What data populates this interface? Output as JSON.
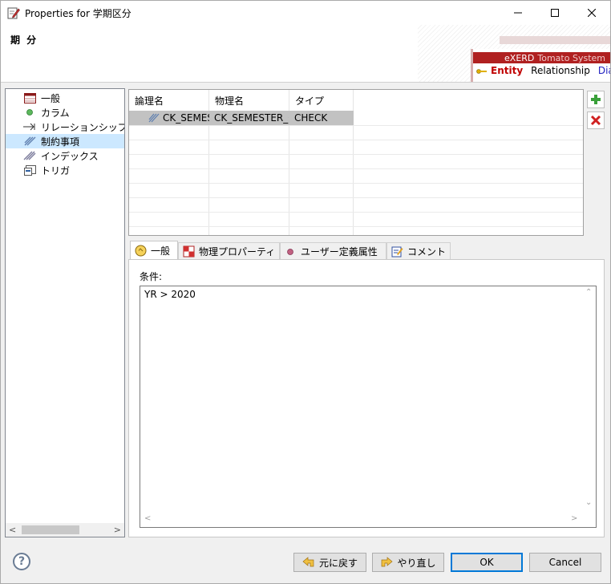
{
  "window": {
    "title": "Properties for 学期区分",
    "heading": "期 分"
  },
  "banner": {
    "brand_main": "eXERD",
    "brand_sub": "Tomato System",
    "tab_entity": "Entity",
    "tab_relationship": "Relationship",
    "tab_diagram": "Diag"
  },
  "tree": {
    "items": [
      {
        "label": "一般",
        "icon": "table-icon"
      },
      {
        "label": "カラム",
        "icon": "column-dot-icon"
      },
      {
        "label": "リレーションシップ",
        "icon": "relationship-arrow-icon"
      },
      {
        "label": "制約事項",
        "icon": "constraint-icon",
        "selected": true
      },
      {
        "label": "インデックス",
        "icon": "index-icon"
      },
      {
        "label": "トリガ",
        "icon": "trigger-icon"
      }
    ]
  },
  "table": {
    "headers": [
      "論理名",
      "物理名",
      "タイプ"
    ],
    "rows": [
      {
        "logical": "CK_SEMESTER_CLASS",
        "physical": "CK_SEMESTER_CLASS",
        "type": "CHECK"
      }
    ]
  },
  "detail_tabs": [
    {
      "label": "一般",
      "icon": "general-icon",
      "active": true
    },
    {
      "label": "物理プロパーティ",
      "icon": "physical-property-icon"
    },
    {
      "label": "ユーザー定義属性",
      "icon": "user-attribute-icon"
    },
    {
      "label": "コメント",
      "icon": "comment-icon"
    }
  ],
  "condition": {
    "label": "条件:",
    "value": "YR > 2020"
  },
  "footer": {
    "help": "?",
    "undo_label": "元に戻す",
    "redo_label": "やり直し",
    "ok_label": "OK",
    "cancel_label": "Cancel"
  },
  "colors": {
    "accent_red": "#b02020",
    "selection_blue": "#cce8ff",
    "ok_border": "#0078d7"
  }
}
